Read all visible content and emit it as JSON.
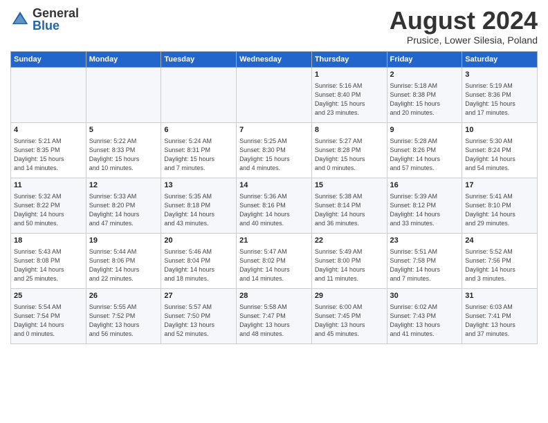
{
  "logo": {
    "general": "General",
    "blue": "Blue"
  },
  "title": "August 2024",
  "subtitle": "Prusice, Lower Silesia, Poland",
  "days_of_week": [
    "Sunday",
    "Monday",
    "Tuesday",
    "Wednesday",
    "Thursday",
    "Friday",
    "Saturday"
  ],
  "weeks": [
    [
      {
        "day": "",
        "info": ""
      },
      {
        "day": "",
        "info": ""
      },
      {
        "day": "",
        "info": ""
      },
      {
        "day": "",
        "info": ""
      },
      {
        "day": "1",
        "info": "Sunrise: 5:16 AM\nSunset: 8:40 PM\nDaylight: 15 hours\nand 23 minutes."
      },
      {
        "day": "2",
        "info": "Sunrise: 5:18 AM\nSunset: 8:38 PM\nDaylight: 15 hours\nand 20 minutes."
      },
      {
        "day": "3",
        "info": "Sunrise: 5:19 AM\nSunset: 8:36 PM\nDaylight: 15 hours\nand 17 minutes."
      }
    ],
    [
      {
        "day": "4",
        "info": "Sunrise: 5:21 AM\nSunset: 8:35 PM\nDaylight: 15 hours\nand 14 minutes."
      },
      {
        "day": "5",
        "info": "Sunrise: 5:22 AM\nSunset: 8:33 PM\nDaylight: 15 hours\nand 10 minutes."
      },
      {
        "day": "6",
        "info": "Sunrise: 5:24 AM\nSunset: 8:31 PM\nDaylight: 15 hours\nand 7 minutes."
      },
      {
        "day": "7",
        "info": "Sunrise: 5:25 AM\nSunset: 8:30 PM\nDaylight: 15 hours\nand 4 minutes."
      },
      {
        "day": "8",
        "info": "Sunrise: 5:27 AM\nSunset: 8:28 PM\nDaylight: 15 hours\nand 0 minutes."
      },
      {
        "day": "9",
        "info": "Sunrise: 5:28 AM\nSunset: 8:26 PM\nDaylight: 14 hours\nand 57 minutes."
      },
      {
        "day": "10",
        "info": "Sunrise: 5:30 AM\nSunset: 8:24 PM\nDaylight: 14 hours\nand 54 minutes."
      }
    ],
    [
      {
        "day": "11",
        "info": "Sunrise: 5:32 AM\nSunset: 8:22 PM\nDaylight: 14 hours\nand 50 minutes."
      },
      {
        "day": "12",
        "info": "Sunrise: 5:33 AM\nSunset: 8:20 PM\nDaylight: 14 hours\nand 47 minutes."
      },
      {
        "day": "13",
        "info": "Sunrise: 5:35 AM\nSunset: 8:18 PM\nDaylight: 14 hours\nand 43 minutes."
      },
      {
        "day": "14",
        "info": "Sunrise: 5:36 AM\nSunset: 8:16 PM\nDaylight: 14 hours\nand 40 minutes."
      },
      {
        "day": "15",
        "info": "Sunrise: 5:38 AM\nSunset: 8:14 PM\nDaylight: 14 hours\nand 36 minutes."
      },
      {
        "day": "16",
        "info": "Sunrise: 5:39 AM\nSunset: 8:12 PM\nDaylight: 14 hours\nand 33 minutes."
      },
      {
        "day": "17",
        "info": "Sunrise: 5:41 AM\nSunset: 8:10 PM\nDaylight: 14 hours\nand 29 minutes."
      }
    ],
    [
      {
        "day": "18",
        "info": "Sunrise: 5:43 AM\nSunset: 8:08 PM\nDaylight: 14 hours\nand 25 minutes."
      },
      {
        "day": "19",
        "info": "Sunrise: 5:44 AM\nSunset: 8:06 PM\nDaylight: 14 hours\nand 22 minutes."
      },
      {
        "day": "20",
        "info": "Sunrise: 5:46 AM\nSunset: 8:04 PM\nDaylight: 14 hours\nand 18 minutes."
      },
      {
        "day": "21",
        "info": "Sunrise: 5:47 AM\nSunset: 8:02 PM\nDaylight: 14 hours\nand 14 minutes."
      },
      {
        "day": "22",
        "info": "Sunrise: 5:49 AM\nSunset: 8:00 PM\nDaylight: 14 hours\nand 11 minutes."
      },
      {
        "day": "23",
        "info": "Sunrise: 5:51 AM\nSunset: 7:58 PM\nDaylight: 14 hours\nand 7 minutes."
      },
      {
        "day": "24",
        "info": "Sunrise: 5:52 AM\nSunset: 7:56 PM\nDaylight: 14 hours\nand 3 minutes."
      }
    ],
    [
      {
        "day": "25",
        "info": "Sunrise: 5:54 AM\nSunset: 7:54 PM\nDaylight: 14 hours\nand 0 minutes."
      },
      {
        "day": "26",
        "info": "Sunrise: 5:55 AM\nSunset: 7:52 PM\nDaylight: 13 hours\nand 56 minutes."
      },
      {
        "day": "27",
        "info": "Sunrise: 5:57 AM\nSunset: 7:50 PM\nDaylight: 13 hours\nand 52 minutes."
      },
      {
        "day": "28",
        "info": "Sunrise: 5:58 AM\nSunset: 7:47 PM\nDaylight: 13 hours\nand 48 minutes."
      },
      {
        "day": "29",
        "info": "Sunrise: 6:00 AM\nSunset: 7:45 PM\nDaylight: 13 hours\nand 45 minutes."
      },
      {
        "day": "30",
        "info": "Sunrise: 6:02 AM\nSunset: 7:43 PM\nDaylight: 13 hours\nand 41 minutes."
      },
      {
        "day": "31",
        "info": "Sunrise: 6:03 AM\nSunset: 7:41 PM\nDaylight: 13 hours\nand 37 minutes."
      }
    ]
  ]
}
